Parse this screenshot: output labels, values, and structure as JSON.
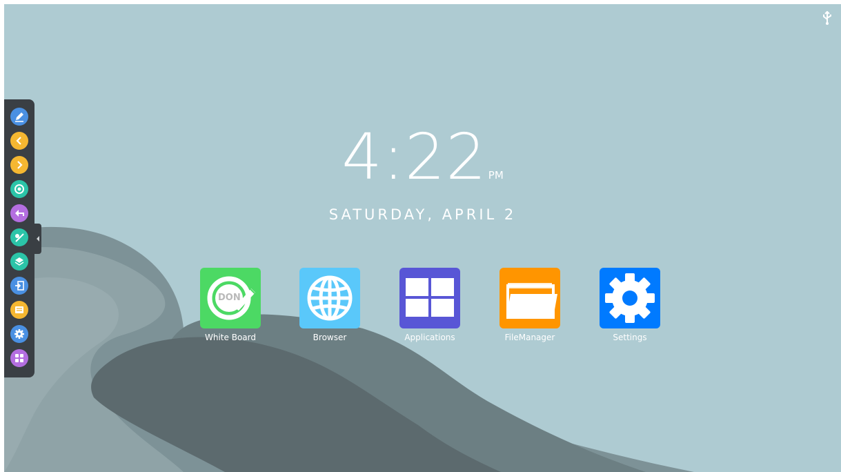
{
  "clock": {
    "time": "4:22",
    "ampm": "PM",
    "date": "SATURDAY, APRIL 2"
  },
  "status": {
    "icon": "usb-icon"
  },
  "apps": [
    {
      "label": "White Board",
      "icon": "whiteboard-icon",
      "color": "#4cd964",
      "logo_text": "DON"
    },
    {
      "label": "Browser",
      "icon": "globe-icon",
      "color": "#5ac8fa"
    },
    {
      "label": "Applications",
      "icon": "grid-icon",
      "color": "#5856d6"
    },
    {
      "label": "FileManager",
      "icon": "folder-icon",
      "color": "#ff9500"
    },
    {
      "label": "Settings",
      "icon": "gear-icon",
      "color": "#007aff"
    }
  ],
  "sidebar": {
    "items": [
      {
        "icon": "pen-icon",
        "color": "#4a90e2"
      },
      {
        "icon": "chevron-left-icon",
        "color": "#f5b731"
      },
      {
        "icon": "chevron-right-icon",
        "color": "#f5b731"
      },
      {
        "icon": "target-icon",
        "color": "#2bc4a8"
      },
      {
        "icon": "back-arrow-icon",
        "color": "#b46ee0"
      },
      {
        "icon": "annotation-icon",
        "color": "#2bc4a8"
      },
      {
        "icon": "layers-icon",
        "color": "#2bc4a8"
      },
      {
        "icon": "input-source-icon",
        "color": "#4a90e2"
      },
      {
        "icon": "toolbox-icon",
        "color": "#f5b731"
      },
      {
        "icon": "settings-icon",
        "color": "#4a90e2"
      },
      {
        "icon": "apps-icon",
        "color": "#b46ee0"
      }
    ]
  }
}
